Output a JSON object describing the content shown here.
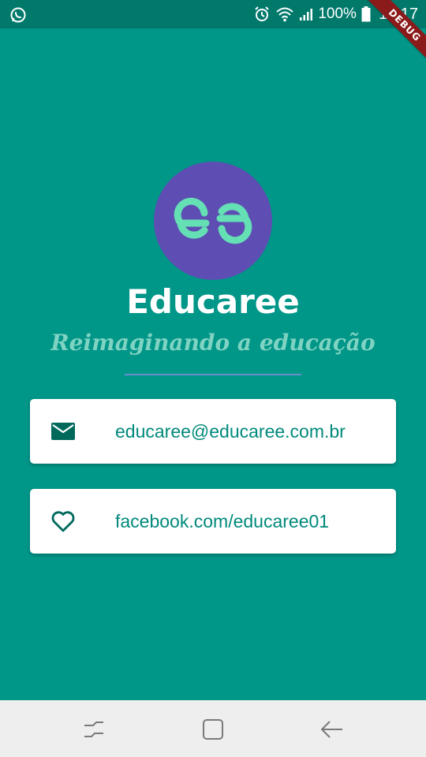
{
  "status_bar": {
    "battery": "100%",
    "time": "10:17",
    "icons": [
      "whatsapp-icon",
      "alarm-icon",
      "wifi-icon",
      "signal-icon",
      "battery-icon"
    ]
  },
  "debug_banner": "DEBUG",
  "app": {
    "logo_text": "ee",
    "title": "Educaree",
    "subtitle": "Reimaginando a educação"
  },
  "contacts": [
    {
      "icon": "mail-icon",
      "label": "educaree@educaree.com.br"
    },
    {
      "icon": "heart-icon",
      "label": "facebook.com/educaree01"
    }
  ],
  "nav_bar": {
    "icons": [
      "recent-apps-icon",
      "home-icon",
      "back-icon"
    ]
  },
  "colors": {
    "background": "#009688",
    "status_bar": "#00796b",
    "logo_circle": "#5e4db3",
    "logo_glyph": "#64e0b4",
    "subtitle": "#7fd3c2",
    "card_text": "#00897b",
    "card_icon": "#00695c"
  }
}
